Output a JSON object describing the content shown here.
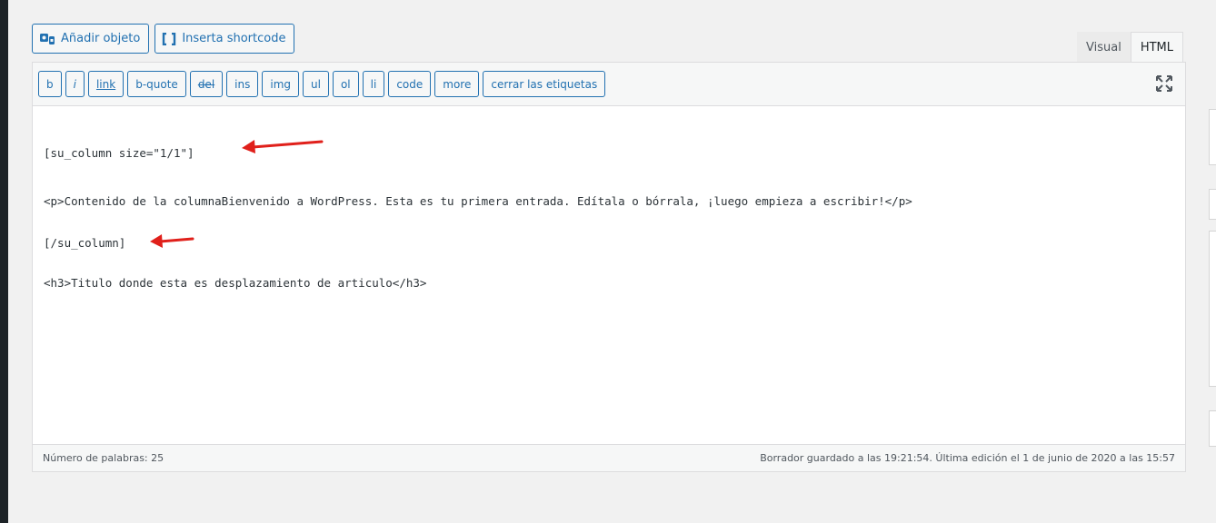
{
  "media": {
    "add_media_label": "Añadir objeto",
    "shortcode_label": "Inserta shortcode"
  },
  "tabs": {
    "visual": "Visual",
    "html": "HTML"
  },
  "quicktags": [
    "b",
    "i",
    "link",
    "b-quote",
    "del",
    "ins",
    "img",
    "ul",
    "ol",
    "li",
    "code",
    "more",
    "cerrar las etiquetas"
  ],
  "content": {
    "line1": "[su_column size=\"1/1\"]",
    "line2": "<p>Contenido de la columnaBienvenido a WordPress. Esta es tu primera entrada. Edítala o bórrala, ¡luego empieza a escribir!</p>",
    "line3": "[/su_column]",
    "line4": "<h3>Titulo donde esta es desplazamiento de articulo</h3>"
  },
  "status": {
    "word_count": "Número de palabras: 25",
    "draft_saved": "Borrador guardado a las 19:21:54. Última edición el 1 de junio de 2020 a las 15:57"
  },
  "colors": {
    "accent": "#2271b1",
    "annotation_arrow": "#e0201b"
  }
}
